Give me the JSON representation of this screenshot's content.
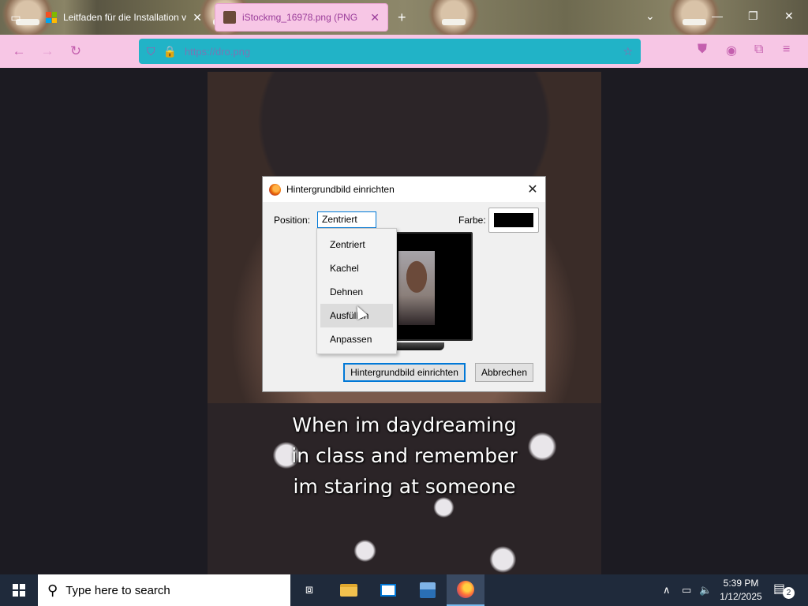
{
  "browser": {
    "tabs": [
      {
        "title": "Leitfaden für die Installation vo",
        "close": "✕"
      },
      {
        "title": "iStockmg_16978.png (PNG",
        "close": "✕"
      }
    ],
    "new_tab": "+",
    "url": "https://dro.png",
    "window_controls": {
      "dropdown": "⌄",
      "minimize": "—",
      "restore": "❐",
      "close": "✕"
    }
  },
  "image": {
    "caption_lines": [
      "When im daydreaming",
      "in class and remember",
      "im staring at someone"
    ]
  },
  "dialog": {
    "title": "Hintergrundbild einrichten",
    "position_label": "Position:",
    "position_value": "Zentriert",
    "color_label": "Farbe:",
    "color_value": "#000000",
    "ok_button": "Hintergrundbild einrichten",
    "cancel_button": "Abbrechen",
    "options": [
      "Zentriert",
      "Kachel",
      "Dehnen",
      "Ausfüllen",
      "Anpassen"
    ],
    "hovered_option": "Ausfüllen"
  },
  "taskbar": {
    "search_placeholder": "Type here to search",
    "time": "5:39 PM",
    "date": "1/12/2025",
    "notification_count": "2"
  },
  "icons": {
    "back": "←",
    "forward": "→",
    "reload": "↻",
    "shield": "⛉",
    "lock": "🔒",
    "star": "☆",
    "pocket": "⛊",
    "account": "◉",
    "extensions": "⧉",
    "menu": "≡",
    "search": "⚲",
    "task_view": "⧈",
    "chevron_up": "∧",
    "network": "▭",
    "volume": "🔈",
    "notifications": "▤"
  }
}
